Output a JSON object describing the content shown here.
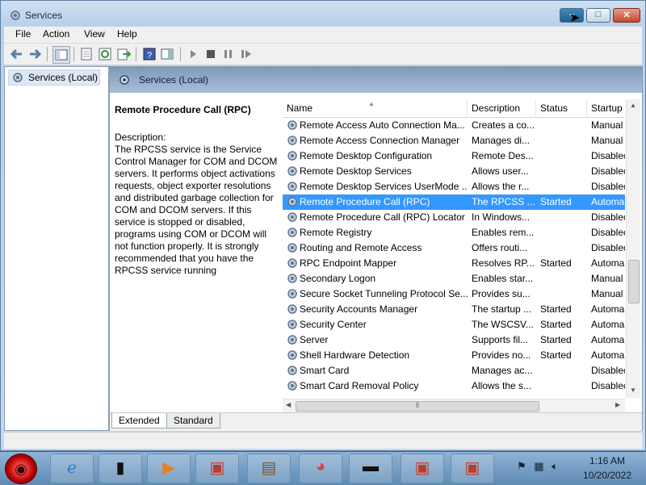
{
  "window": {
    "title": "Services",
    "controls": {
      "minimize": "–",
      "maximize": "□",
      "close": "✕"
    }
  },
  "menu": [
    "File",
    "Action",
    "View",
    "Help"
  ],
  "toolbar_icons": [
    "back-arrow-icon",
    "forward-arrow-icon",
    "console-tree-icon",
    "properties-icon",
    "refresh-icon",
    "export-list-icon",
    "help-icon",
    "show-hide-action-pane-icon",
    "start-service-icon",
    "stop-service-icon",
    "pause-service-icon",
    "restart-service-icon"
  ],
  "left_pane": {
    "item_label": "Services (Local)"
  },
  "right_pane": {
    "header": "Services (Local)",
    "selected_service_title": "Remote Procedure Call (RPC)",
    "description_label": "Description:",
    "description_text": "The RPCSS service is the Service Control Manager for COM and DCOM servers. It performs object activations requests, object exporter resolutions and distributed garbage collection for COM and DCOM servers. If this service is stopped or disabled, programs using COM or DCOM will not function properly. It is strongly recommended that you have the RPCSS service running"
  },
  "table": {
    "columns": [
      "Name",
      "Description",
      "Status",
      "Startup T"
    ],
    "rows": [
      {
        "name": "Remote Access Auto Connection Ma...",
        "description": "Creates a co...",
        "status": "",
        "startup": "Manual"
      },
      {
        "name": "Remote Access Connection Manager",
        "description": "Manages di...",
        "status": "",
        "startup": "Manual"
      },
      {
        "name": "Remote Desktop Configuration",
        "description": "Remote Des...",
        "status": "",
        "startup": "Disablec"
      },
      {
        "name": "Remote Desktop Services",
        "description": "Allows user...",
        "status": "",
        "startup": "Disablec"
      },
      {
        "name": "Remote Desktop Services UserMode ...",
        "description": "Allows the r...",
        "status": "",
        "startup": "Disablec"
      },
      {
        "name": "Remote Procedure Call (RPC)",
        "description": "The RPCSS ...",
        "status": "Started",
        "startup": "Automa",
        "selected": true
      },
      {
        "name": "Remote Procedure Call (RPC) Locator",
        "description": "In Windows...",
        "status": "",
        "startup": "Disablec"
      },
      {
        "name": "Remote Registry",
        "description": "Enables rem...",
        "status": "",
        "startup": "Disablec"
      },
      {
        "name": "Routing and Remote Access",
        "description": "Offers routi...",
        "status": "",
        "startup": "Disablec"
      },
      {
        "name": "RPC Endpoint Mapper",
        "description": "Resolves RP...",
        "status": "Started",
        "startup": "Automa"
      },
      {
        "name": "Secondary Logon",
        "description": "Enables star...",
        "status": "",
        "startup": "Manual"
      },
      {
        "name": "Secure Socket Tunneling Protocol Se...",
        "description": "Provides su...",
        "status": "",
        "startup": "Manual"
      },
      {
        "name": "Security Accounts Manager",
        "description": "The startup ...",
        "status": "Started",
        "startup": "Automa"
      },
      {
        "name": "Security Center",
        "description": "The WSCSV...",
        "status": "Started",
        "startup": "Automa"
      },
      {
        "name": "Server",
        "description": "Supports fil...",
        "status": "Started",
        "startup": "Automa"
      },
      {
        "name": "Shell Hardware Detection",
        "description": "Provides no...",
        "status": "Started",
        "startup": "Automa"
      },
      {
        "name": "Smart Card",
        "description": "Manages ac...",
        "status": "",
        "startup": "Disablec"
      },
      {
        "name": "Smart Card Removal Policy",
        "description": "Allows the s...",
        "status": "",
        "startup": "Disablec"
      }
    ]
  },
  "tabs": [
    "Extended",
    "Standard"
  ],
  "taskbar": {
    "items": [
      "start-orb-icon",
      "internet-explorer-icon",
      "device-icon",
      "media-player-icon",
      "toolbox-icon",
      "control-panel-icon",
      "chrome-icon",
      "command-prompt-icon",
      "toolbox-icon",
      "toolbox-icon"
    ],
    "time": "1:16 AM",
    "date": "10/20/2022"
  },
  "colors": {
    "selection": "#3399ff",
    "title_bar": "#b9d1ea",
    "close_button": "#c9452d"
  }
}
